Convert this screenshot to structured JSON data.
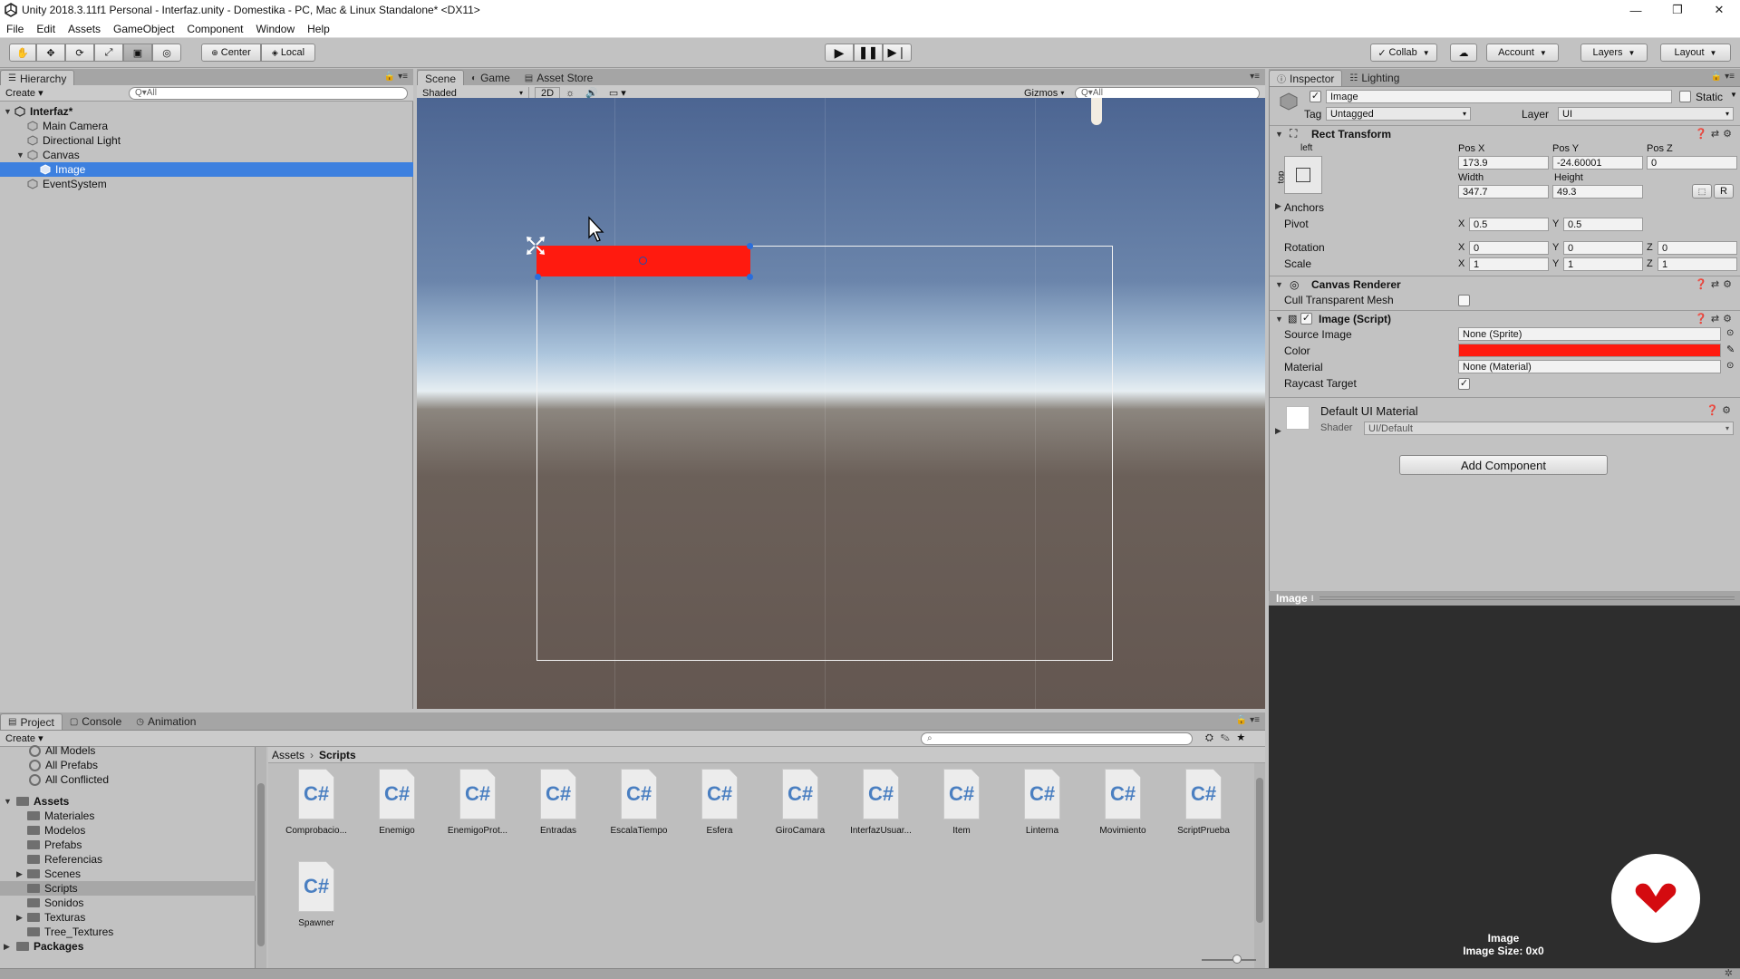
{
  "window": {
    "title": "Unity 2018.3.11f1 Personal - Interfaz.unity - Domestika - PC, Mac & Linux Standalone* <DX11>",
    "controls": [
      "—",
      "❐",
      "✕"
    ]
  },
  "menu": [
    "File",
    "Edit",
    "Assets",
    "GameObject",
    "Component",
    "Window",
    "Help"
  ],
  "toolbar": {
    "pivot": "Center",
    "space": "Local",
    "collab": "Collab",
    "account": "Account",
    "layers": "Layers",
    "layout": "Layout"
  },
  "hierarchy": {
    "tab": "Hierarchy",
    "create": "Create",
    "search_placeholder": "Q▾All",
    "scene": "Interfaz*",
    "items": [
      {
        "label": "Main Camera"
      },
      {
        "label": "Directional Light"
      },
      {
        "label": "Canvas"
      },
      {
        "label": "Image",
        "selected": true
      },
      {
        "label": "EventSystem"
      }
    ]
  },
  "scene_view": {
    "tabs": [
      "Scene",
      "Game",
      "Asset Store"
    ],
    "shading": "Shaded",
    "mode_2d": "2D",
    "gizmos": "Gizmos",
    "search_placeholder": "Q▾All",
    "image_color": "#ff1a0f"
  },
  "inspector": {
    "tabs": [
      "Inspector",
      "Lighting"
    ],
    "object_name": "Image",
    "static_label": "Static",
    "tag_label": "Tag",
    "tag_value": "Untagged",
    "layer_label": "Layer",
    "layer_value": "UI",
    "rect": {
      "title": "Rect Transform",
      "anchor_h": "left",
      "anchor_v": "top",
      "pos_x_label": "Pos X",
      "pos_y_label": "Pos Y",
      "pos_z_label": "Pos Z",
      "pos_x": "173.9",
      "pos_y": "-24.60001",
      "pos_z": "0",
      "width_label": "Width",
      "height_label": "Height",
      "width": "347.7",
      "height": "49.3",
      "anchors_label": "Anchors",
      "pivot_label": "Pivot",
      "pivot_x": "0.5",
      "pivot_y": "0.5",
      "rotation_label": "Rotation",
      "rot_x": "0",
      "rot_y": "0",
      "rot_z": "0",
      "scale_label": "Scale",
      "scale_x": "1",
      "scale_y": "1",
      "scale_z": "1",
      "axis_x": "X",
      "axis_y": "Y",
      "axis_z": "Z",
      "r_btn": "R"
    },
    "canvas_renderer": {
      "title": "Canvas Renderer",
      "cull_label": "Cull Transparent Mesh"
    },
    "image_script": {
      "title": "Image (Script)",
      "source_label": "Source Image",
      "source_value": "None (Sprite)",
      "color_label": "Color",
      "color_value": "#ff1a0f",
      "material_label": "Material",
      "material_value": "None (Material)",
      "raycast_label": "Raycast Target"
    },
    "material": {
      "name": "Default UI Material",
      "shader_label": "Shader",
      "shader_value": "UI/Default"
    },
    "add_component": "Add Component"
  },
  "preview": {
    "title": "Image",
    "caption_name": "Image",
    "caption_size": "Image Size: 0x0"
  },
  "project": {
    "tabs": [
      "Project",
      "Console",
      "Animation"
    ],
    "create": "Create",
    "favorites": [
      "All Models",
      "All Prefabs",
      "All Conflicted"
    ],
    "assets_root": "Assets",
    "folders": [
      {
        "label": "Materiales",
        "expandable": false
      },
      {
        "label": "Modelos",
        "expandable": false
      },
      {
        "label": "Prefabs",
        "expandable": false
      },
      {
        "label": "Referencias",
        "expandable": false
      },
      {
        "label": "Scenes",
        "expandable": true
      },
      {
        "label": "Scripts",
        "expandable": false,
        "selected": true
      },
      {
        "label": "Sonidos",
        "expandable": false
      },
      {
        "label": "Texturas",
        "expandable": true
      },
      {
        "label": "Tree_Textures",
        "expandable": false
      }
    ],
    "packages_root": "Packages",
    "breadcrumb": [
      "Assets",
      "Scripts"
    ],
    "assets": [
      "Comprobacio...",
      "Enemigo",
      "EnemigoProt...",
      "Entradas",
      "EscalaTiempo",
      "Esfera",
      "GiroCamara",
      "InterfazUsuar...",
      "Item",
      "Linterna",
      "Movimiento",
      "ScriptPrueba",
      "Spawner"
    ],
    "csharp_glyph": "C#"
  }
}
